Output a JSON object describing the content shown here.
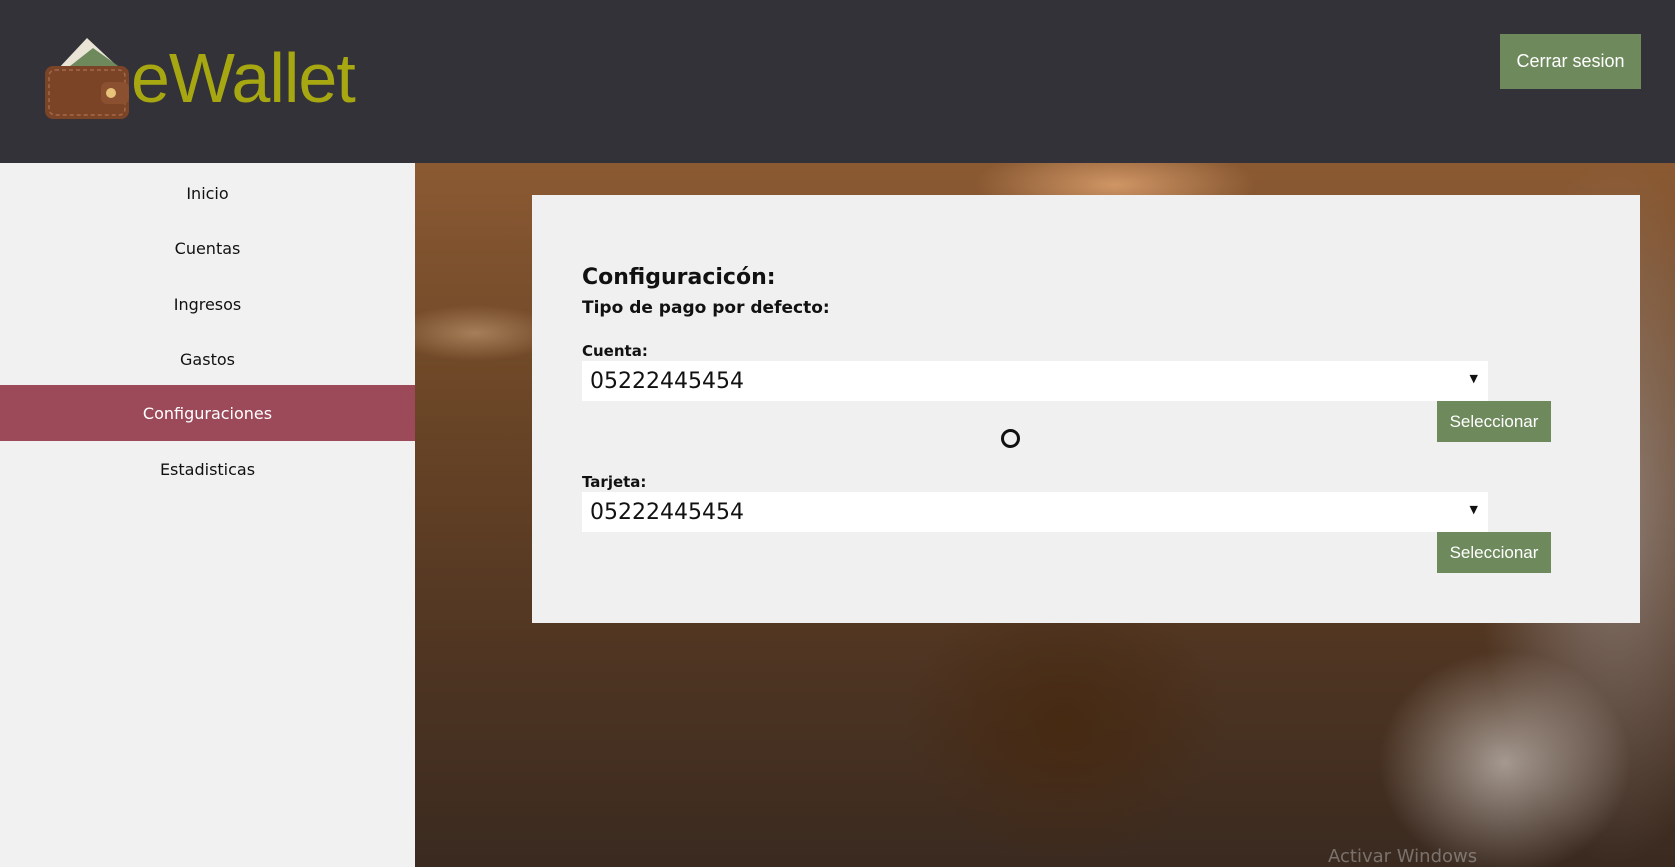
{
  "header": {
    "logo_text": "eWallet",
    "logout_label": "Cerrar sesion"
  },
  "sidebar": {
    "items": [
      {
        "label": "Inicio"
      },
      {
        "label": "Cuentas"
      },
      {
        "label": "Ingresos"
      },
      {
        "label": "Gastos"
      },
      {
        "label": "Configuraciones",
        "active": true
      },
      {
        "label": "Estadisticas"
      }
    ]
  },
  "main": {
    "title": "Configuracicón:",
    "subtitle": "Tipo de pago por defecto:",
    "account": {
      "label": "Cuenta:",
      "selected": "05222445454",
      "button": "Seleccionar"
    },
    "card": {
      "label": "Tarjeta:",
      "selected": "05222445454",
      "button": "Seleccionar"
    }
  },
  "watermark": "Activar Windows",
  "colors": {
    "header_bg": "#333238",
    "logo_text": "#a7a711",
    "button_bg": "#6e8a5d",
    "active_nav_bg": "#9c4a5a",
    "sidebar_bg": "#f1f1f1"
  }
}
